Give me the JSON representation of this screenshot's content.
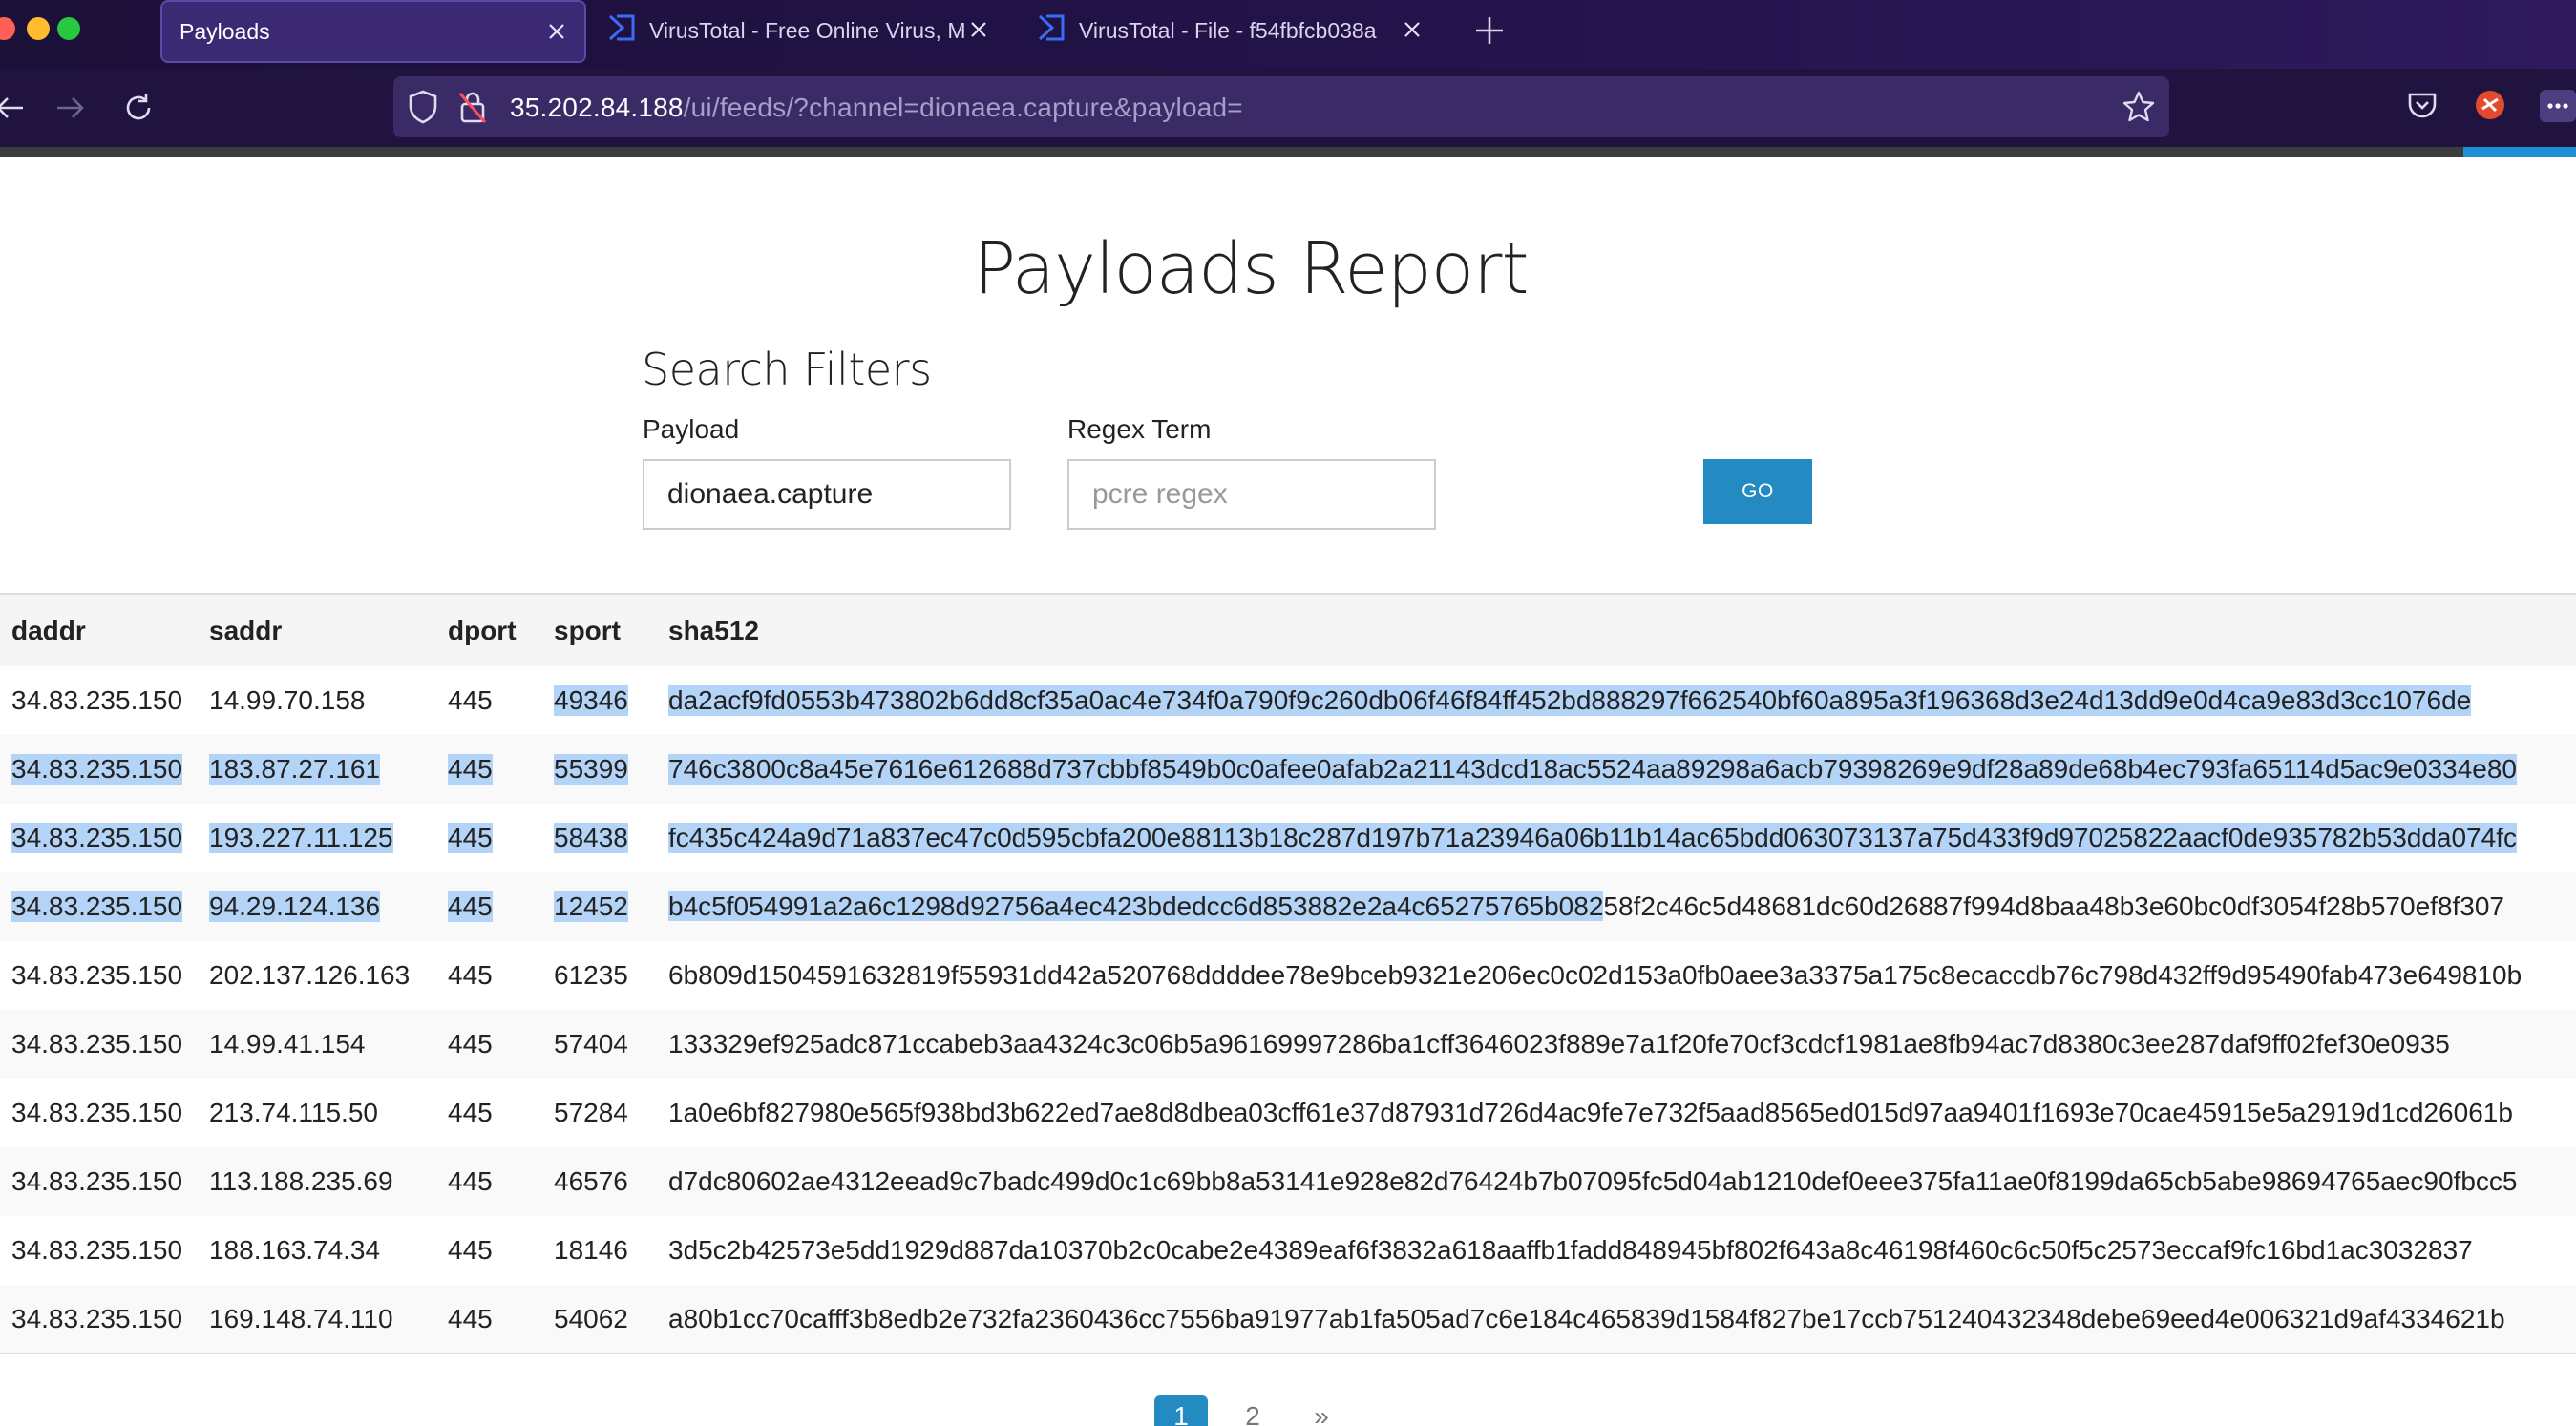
{
  "browser": {
    "tabs": [
      {
        "title": "Payloads",
        "active": true
      },
      {
        "title": "VirusTotal - Free Online Virus, M",
        "active": false
      },
      {
        "title": "VirusTotal - File - f54fbfcb038a",
        "active": false
      }
    ],
    "url_host": "35.202.84.188",
    "url_path": "/ui/feeds/?channel=dionaea.capture&payload="
  },
  "page": {
    "title": "Payloads Report",
    "filters_title": "Search Filters",
    "payload_label": "Payload",
    "payload_value": "dionaea.capture",
    "regex_label": "Regex Term",
    "regex_placeholder": "pcre regex",
    "go_label": "GO"
  },
  "table": {
    "headers": [
      "daddr",
      "saddr",
      "dport",
      "sport",
      "sha512"
    ],
    "rows": [
      {
        "daddr": "34.83.235.150",
        "saddr": "14.99.70.158",
        "dport": "445",
        "sport": "49346",
        "sha512": "da2acf9fd0553b473802b6dd8cf35a0ac4e734f0a790f9c260db06f46f84ff452bd888297f662540bf60a895a3f196368d3e24d13dd9e0d4ca9e83d3cc1076de"
      },
      {
        "daddr": "34.83.235.150",
        "saddr": "183.87.27.161",
        "dport": "445",
        "sport": "55399",
        "sha512": "746c3800c8a45e7616e612688d737cbbf8549b0c0afee0afab2a21143dcd18ac5524aa89298a6acb79398269e9df28a89de68b4ec793fa65114d5ac9e0334e80"
      },
      {
        "daddr": "34.83.235.150",
        "saddr": "193.227.11.125",
        "dport": "445",
        "sport": "58438",
        "sha512": "fc435c424a9d71a837ec47c0d595cbfa200e88113b18c287d197b71a23946a06b11b14ac65bdd063073137a75d433f9d97025822aacf0de935782b53dda074fc"
      },
      {
        "daddr": "34.83.235.150",
        "saddr": "94.29.124.136",
        "dport": "445",
        "sport": "12452",
        "sha512": "b4c5f054991a2a6c1298d92756a4ec423bdedcc6d853882e2a4c65275765b08258f2c46c5d48681dc60d26887f994d8baa48b3e60bc0df3054f28b570ef8f307"
      },
      {
        "daddr": "34.83.235.150",
        "saddr": "202.137.126.163",
        "dport": "445",
        "sport": "61235",
        "sha512": "6b809d1504591632819f55931dd42a520768ddddee78e9bceb9321e206ec0c02d153a0fb0aee3a3375a175c8ecaccdb76c798d432ff9d95490fab473e649810b"
      },
      {
        "daddr": "34.83.235.150",
        "saddr": "14.99.41.154",
        "dport": "445",
        "sport": "57404",
        "sha512": "133329ef925adc871ccabeb3aa4324c3c06b5a96169997286ba1cff3646023f889e7a1f20fe70cf3cdcf1981ae8fb94ac7d8380c3ee287daf9ff02fef30e0935"
      },
      {
        "daddr": "34.83.235.150",
        "saddr": "213.74.115.50",
        "dport": "445",
        "sport": "57284",
        "sha512": "1a0e6bf827980e565f938bd3b622ed7ae8d8dbea03cff61e37d87931d726d4ac9fe7e732f5aad8565ed015d97aa9401f1693e70cae45915e5a2919d1cd26061b"
      },
      {
        "daddr": "34.83.235.150",
        "saddr": "113.188.235.69",
        "dport": "445",
        "sport": "46576",
        "sha512": "d7dc80602ae4312eead9c7badc499d0c1c69bb8a53141e928e82d76424b7b07095fc5d04ab1210def0eee375fa11ae0f8199da65cb5abe98694765aec90fbcc5"
      },
      {
        "daddr": "34.83.235.150",
        "saddr": "188.163.74.34",
        "dport": "445",
        "sport": "18146",
        "sha512": "3d5c2b42573e5dd1929d887da10370b2c0cabe2e4389eaf6f3832a618aaffb1fadd848945bf802f643a8c46198f460c6c50f5c2573eccaf9fc16bd1ac3032837"
      },
      {
        "daddr": "34.83.235.150",
        "saddr": "169.148.74.110",
        "dport": "445",
        "sport": "54062",
        "sha512": "a80b1cc70cafff3b8edb2e732fa2360436cc7556ba91977ab1fa505ad7c6e184c465839d1584f827be17ccb751240432348debe69eed4e006321d9af4334621b"
      }
    ]
  },
  "pagination": {
    "pages": [
      "1",
      "2"
    ],
    "current": "1",
    "next": "»"
  },
  "colors": {
    "go_button": "#238ac2",
    "selection_highlight": "#b3d4f7",
    "browser_chrome": "#21133f"
  }
}
